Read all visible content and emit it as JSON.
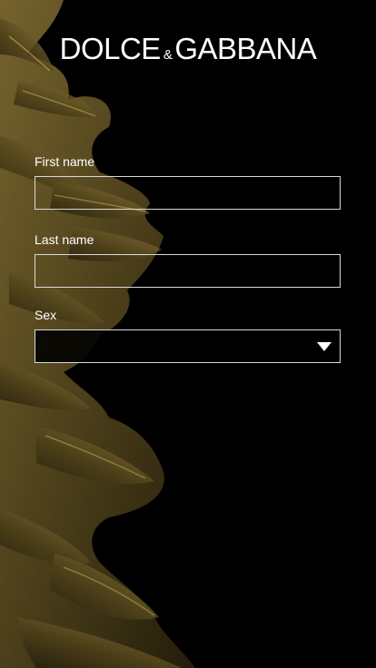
{
  "brand": {
    "logo_left": "DOLCE",
    "logo_amp": "&",
    "logo_right": "GABBANA"
  },
  "form": {
    "first_name_label": "First name",
    "first_name_value": "",
    "last_name_label": "Last name",
    "last_name_value": "",
    "sex_label": "Sex",
    "sex_value": ""
  },
  "icons": {
    "select_arrow": "chevron-down-icon",
    "background": "golden-foliage-illustration"
  },
  "colors": {
    "background": "#000000",
    "text": "#ffffff",
    "field_border": "#d9d9d9",
    "foliage": "#6b5a2a"
  }
}
